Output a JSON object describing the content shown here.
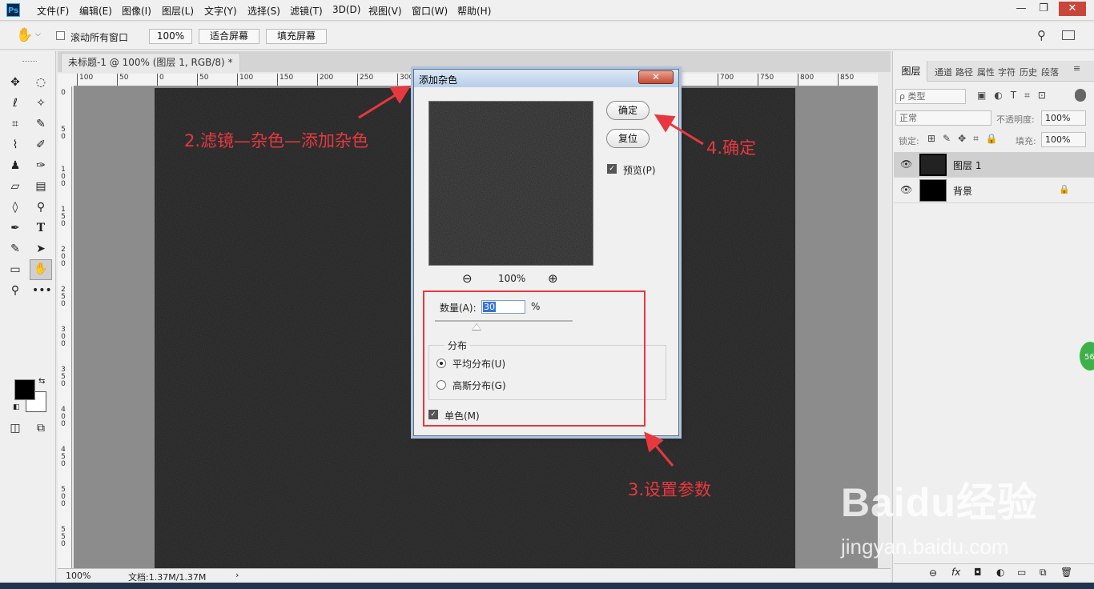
{
  "menubar": {
    "logo": "Ps",
    "items": [
      "文件(F)",
      "编辑(E)",
      "图像(I)",
      "图层(L)",
      "文字(Y)",
      "选择(S)",
      "滤镜(T)",
      "3D(D)",
      "视图(V)",
      "窗口(W)",
      "帮助(H)"
    ],
    "window_buttons": [
      "—",
      "❐",
      "✕"
    ]
  },
  "options": {
    "scroll_all_label": "滚动所有窗口",
    "zoom_value": "100%",
    "fit_screen": "适合屏幕",
    "fill_screen": "填充屏幕"
  },
  "document": {
    "tab_title": "未标题-1 @ 100% (图层 1, RGB/8) *",
    "tab_close": "×",
    "h_ruler": [
      "100",
      "50",
      "0",
      "50",
      "100",
      "150",
      "200",
      "250",
      "300",
      "700",
      "750",
      "800",
      "850"
    ],
    "v_ruler": [
      "0",
      "5 0",
      "1 0 0",
      "1 5 0",
      "2 0 0",
      "2 5 0",
      "3 0 0",
      "3 5 0",
      "4 0 0",
      "4 5 0",
      "5 0 0",
      "5 5 0"
    ],
    "status_zoom": "100%",
    "status_doc": "文档:1.37M/1.37M",
    "status_arrow": "›"
  },
  "dialog": {
    "title": "添加杂色",
    "close": "✕",
    "ok": "确定",
    "reset": "复位",
    "preview_label": "预览(P)",
    "zoom_out": "−",
    "zoom_level": "100%",
    "zoom_in": "+",
    "amount_label": "数量(A):",
    "amount_value": "30",
    "amount_unit": "%",
    "amount_fraction": 0.3,
    "distribution_label": "分布",
    "uniform_label": "平均分布(U)",
    "gaussian_label": "高斯分布(G)",
    "mono_label": "单色(M)"
  },
  "annotations": {
    "step2": "2.滤镜—杂色—添加杂色",
    "step3": "3.设置参数",
    "step4": "4.确定"
  },
  "panel": {
    "tabs": [
      "图层",
      "通道",
      "路径",
      "属性",
      "字符",
      "历史",
      "段落"
    ],
    "kind": "ρ 类型",
    "blend": "正常",
    "opacity_label": "不透明度:",
    "opacity_value": "100%",
    "lock_label": "锁定:",
    "fill_label": "填充:",
    "fill_value": "100%",
    "layers": [
      {
        "name": "图层 1"
      },
      {
        "name": "背景"
      }
    ],
    "bottom_icons": [
      "⊖",
      "fx",
      "◘",
      "◐",
      "▭",
      "⧉",
      "🗑"
    ]
  },
  "watermark": {
    "brand": "Baidu经验",
    "url": "jingyan.baidu.com",
    "badge": "56"
  },
  "colors": {
    "annotation": "#e8383f",
    "canvas": "#1a1a1a"
  }
}
